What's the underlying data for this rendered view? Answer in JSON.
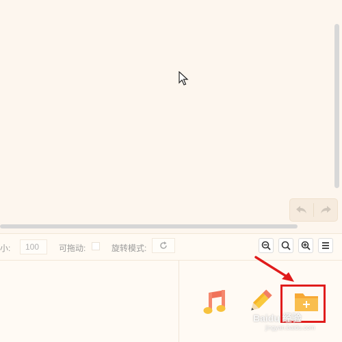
{
  "toolbar": {
    "size_label": "大小:",
    "size_value": "100",
    "draggable_label": "可拖动:",
    "rotate_label": "旋转模式:"
  },
  "icons": {
    "undo": "undo-icon",
    "redo": "redo-icon",
    "rotate": "rotate-icon",
    "zoom_out": "zoom-out-icon",
    "zoom_reset": "zoom-reset-icon",
    "zoom_in": "zoom-in-icon",
    "menu": "menu-icon",
    "music": "music-icon",
    "pencil": "pencil-icon",
    "folder_add": "folder-add-icon"
  },
  "colors": {
    "background": "#fdf6ee",
    "highlight": "#e01b1b",
    "music": "#f0735a",
    "folder": "#f7a935"
  },
  "watermark": {
    "brand": "Baidu 经验",
    "url": "jingyan.baidu.com"
  }
}
